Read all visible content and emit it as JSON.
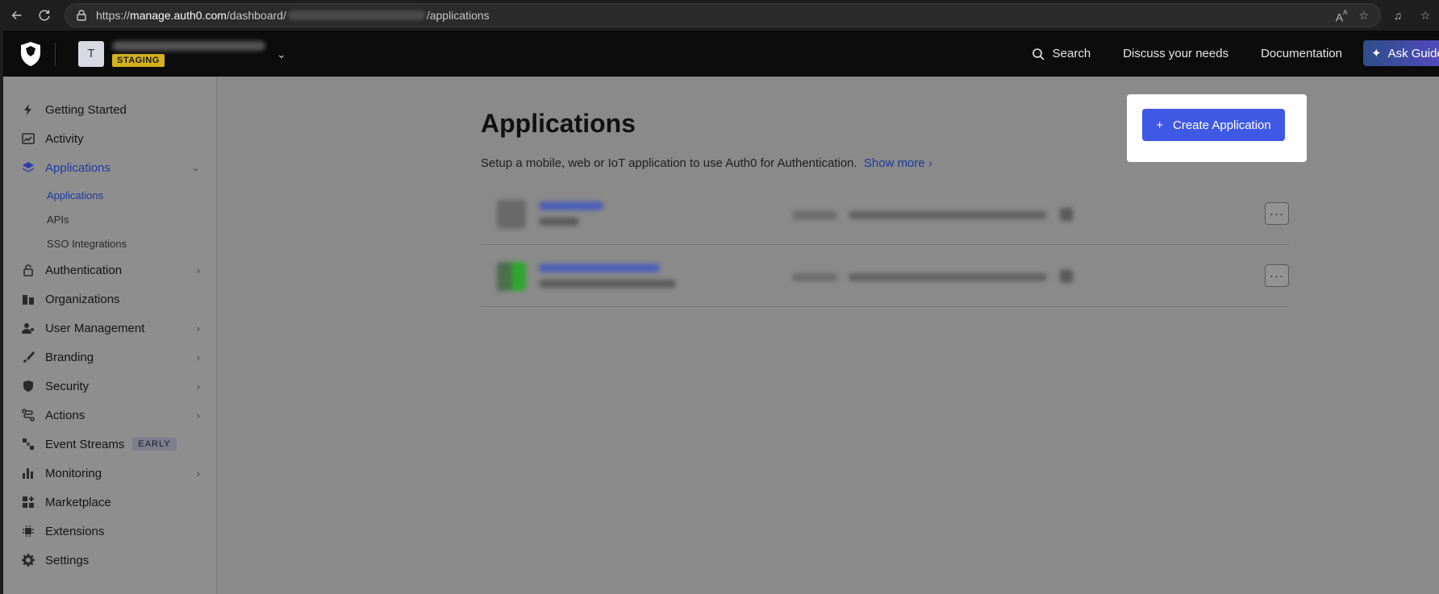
{
  "browser": {
    "url_prefix": "https://",
    "url_host": "manage.auth0.com",
    "url_path_start": "/dashboard/",
    "url_path_end": "/applications"
  },
  "header": {
    "tenant_initial": "T",
    "env_badge": "STAGING",
    "links": {
      "search": "Search",
      "discuss": "Discuss your needs",
      "docs": "Documentation"
    },
    "ask_button": "Ask Guide"
  },
  "sidebar": {
    "items": [
      {
        "label": "Getting Started",
        "icon": "bolt-icon"
      },
      {
        "label": "Activity",
        "icon": "chart-line-icon"
      },
      {
        "label": "Applications",
        "icon": "layers-icon"
      },
      {
        "label": "Authentication",
        "icon": "lock-icon"
      },
      {
        "label": "Organizations",
        "icon": "building-icon"
      },
      {
        "label": "User Management",
        "icon": "user-icon"
      },
      {
        "label": "Branding",
        "icon": "brush-icon"
      },
      {
        "label": "Security",
        "icon": "shield-icon"
      },
      {
        "label": "Actions",
        "icon": "flow-icon"
      },
      {
        "label": "Event Streams",
        "icon": "stream-icon"
      },
      {
        "label": "Monitoring",
        "icon": "bar-chart-icon"
      },
      {
        "label": "Marketplace",
        "icon": "grid-plus-icon"
      },
      {
        "label": "Extensions",
        "icon": "chip-icon"
      },
      {
        "label": "Settings",
        "icon": "gear-icon"
      }
    ],
    "sub_items": [
      "Applications",
      "APIs",
      "SSO Integrations"
    ],
    "early_badge": "EARLY"
  },
  "main": {
    "title": "Applications",
    "description": "Setup a mobile, web or IoT application to use Auth0 for Authentication.",
    "show_more": "Show more",
    "create_button": "Create Application",
    "row_menu": "···"
  },
  "colors": {
    "accent": "#3f59e4",
    "link": "#1f3a9e",
    "staging_badge": "#d4b11d"
  }
}
